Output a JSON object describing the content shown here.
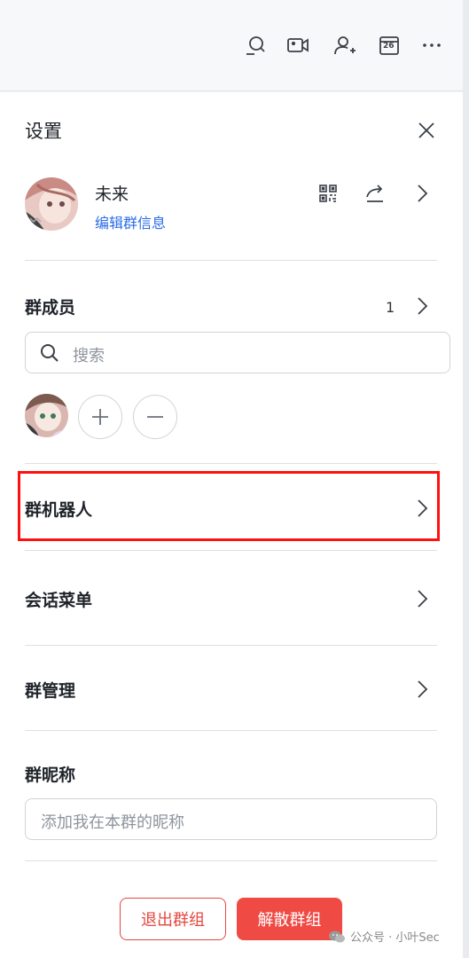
{
  "settings": {
    "title": "设置"
  },
  "topbar": {
    "calendar_day": "26",
    "icons": [
      "search-chat-icon",
      "video-call-icon",
      "add-member-icon",
      "calendar-icon",
      "more-icon"
    ]
  },
  "group": {
    "name": "未来",
    "edit_label": "编辑群信息"
  },
  "members": {
    "title": "群成员",
    "count": "1",
    "search_placeholder": "搜索"
  },
  "rows": {
    "bots": "群机器人",
    "session_menu": "会话菜单",
    "management": "群管理"
  },
  "nickname": {
    "title": "群昵称",
    "placeholder": "添加我在本群的昵称"
  },
  "actions": {
    "exit": "退出群组",
    "dissolve": "解散群组"
  },
  "watermark": {
    "text": "公众号 · 小叶Sec"
  },
  "colors": {
    "accent_link": "#2b6de5",
    "danger": "#ef4a44",
    "highlight": "#ff1010"
  }
}
